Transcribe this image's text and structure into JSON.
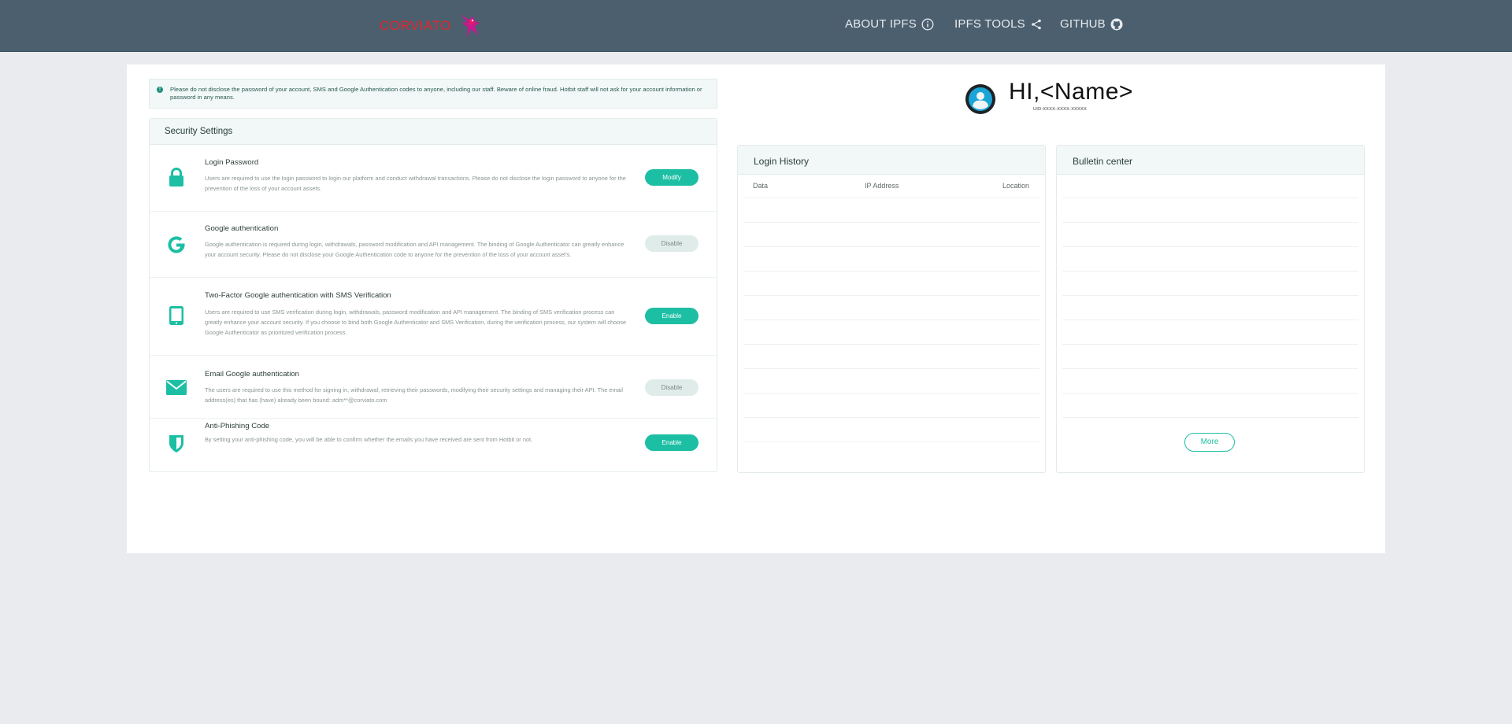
{
  "header": {
    "brand": "CORVIATO",
    "nav": [
      {
        "label": "ABOUT IPFS",
        "icon": "info-circle-icon"
      },
      {
        "label": "IPFS TOOLS",
        "icon": "share-icon"
      },
      {
        "label": "GITHUB",
        "icon": "github-icon"
      }
    ]
  },
  "notice": {
    "text": "Please do not disclose the password of your account, SMS and Google Authentication codes to anyone, including our staff. Beware of online fraud. Hotbit staff will not ask for your account information or password in any means."
  },
  "security": {
    "title": "Security Settings",
    "items": [
      {
        "icon": "lock-icon",
        "title": "Login Password",
        "desc": "Users are required to use the login password to login our platform and conduct withdrawal transactions. Please do not disclose the login password to anyone for the prevention of the loss of your account assets.",
        "button": "Modify",
        "state": "on"
      },
      {
        "icon": "google-icon",
        "title": "Google authentication",
        "desc": "Google authentication is required during login, withdrawals, password modification and API management. The binding of Google Authenticator can greatly enhance your account security. Please do not disclose your Google Authentication code to anyone for the prevention of the loss of your account asset's.",
        "button": "Disable",
        "state": "off"
      },
      {
        "icon": "tablet-icon",
        "title": "Two-Factor Google authentication with SMS Verification",
        "desc": "Users are required to use SMS verification during login, withdrawals, password modification and API management. The binding of SMS verification process can greatly enhance your account security. If you choose to bind both Google Authenticator and SMS Verification, during the verification process, our system will choose Google Authenticator as prioritized verification process.",
        "button": "Enable",
        "state": "on"
      },
      {
        "icon": "envelope-icon",
        "title": "Email Google authentication",
        "desc": "The users are required to use this method for signing in, withdrawal, retrieving their passwords, modifying their security settings and managing their API. The email address(es) that has (have) already been bound: adm**@corviato.com",
        "button": "Disable",
        "state": "off"
      },
      {
        "icon": "shield-icon",
        "title": "Anti-Phishing Code",
        "desc": "By setting your anti-phishing code, you will be able to confirm whether the emails you have received are sent from Hotbit or not.",
        "button": "Enable",
        "state": "on"
      }
    ]
  },
  "user": {
    "greeting": "HI,<Name>",
    "uid": "UID:XXXX-XXXX-XXXXX"
  },
  "login_history": {
    "title": "Login History",
    "columns": [
      "Data",
      "IP Address",
      "Location"
    ]
  },
  "bulletin": {
    "title": "Bulletin center",
    "more_label": "More"
  },
  "colors": {
    "nav_bg": "#4c5f6e",
    "accent": "#1dbfa4",
    "brand": "#e3262b",
    "page_bg": "#e9ebee"
  }
}
